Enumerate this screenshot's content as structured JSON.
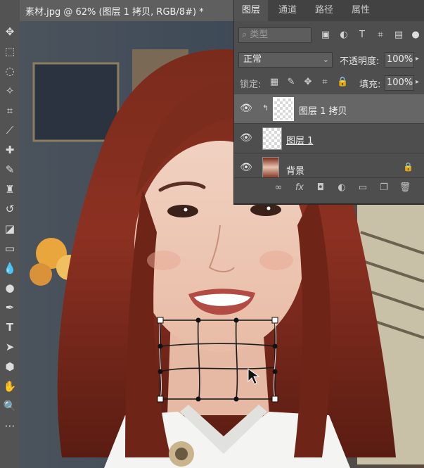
{
  "document": {
    "title": "素材.jpg @ 62% (图层 1 拷贝, RGB/8#) *",
    "close_glyph": "×"
  },
  "layers_panel": {
    "tabs": [
      {
        "label": "图层"
      },
      {
        "label": "通道"
      },
      {
        "label": "路径"
      },
      {
        "label": "属性"
      }
    ],
    "filter_placeholder": "类型",
    "blend_mode": "正常",
    "opacity_label": "不透明度:",
    "opacity_value": "100%",
    "lock_label": "锁定:",
    "fill_label": "填充:",
    "fill_value": "100%",
    "layers": [
      {
        "name": "图层 1 拷贝",
        "selected": true
      },
      {
        "name": "图层 1",
        "selected": false
      },
      {
        "name": "背景",
        "selected": false
      }
    ]
  },
  "colors": {
    "accent": "#2d8cff",
    "panel_bg": "#4e4e4e",
    "toolbar_bg": "#535353"
  }
}
